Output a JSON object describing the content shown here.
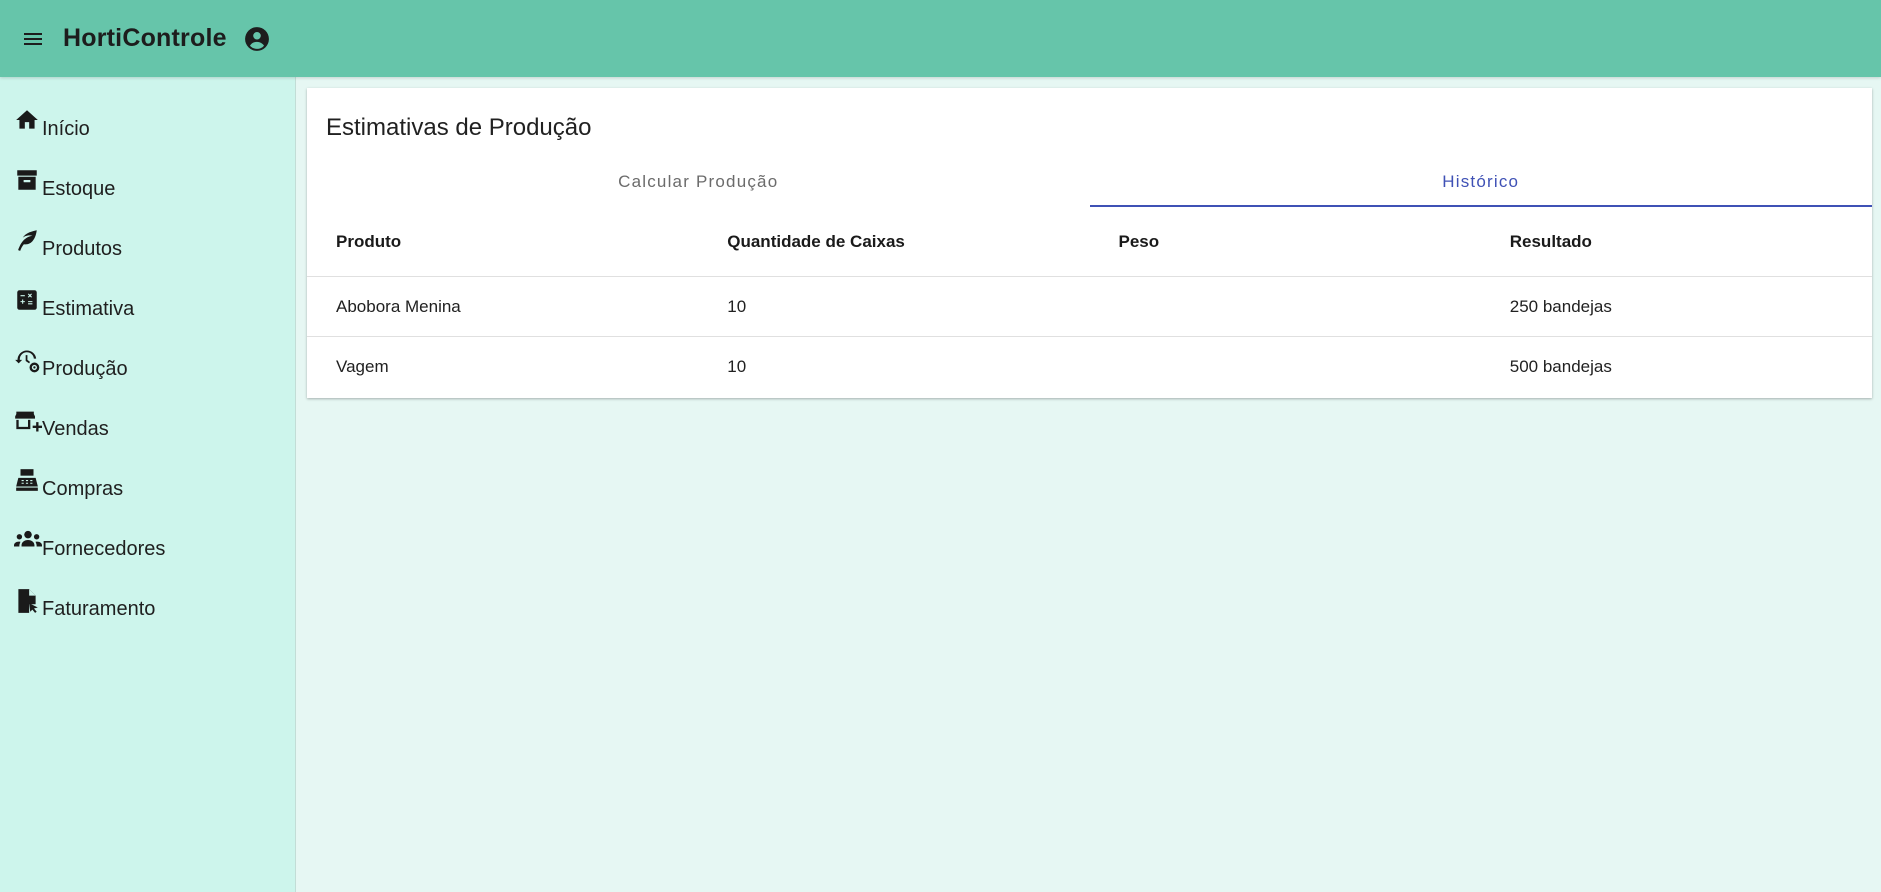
{
  "app": {
    "title": "HortiControle"
  },
  "icons": {
    "menu": "menu-icon",
    "account": "account-circle-icon"
  },
  "colors": {
    "appbar": "#66c5aa",
    "sidebar": "#cdf5ec",
    "background": "#e6f7f3",
    "accent": "#3f51b5"
  },
  "sidebar": {
    "items": [
      {
        "label": "Início",
        "icon": "home-icon"
      },
      {
        "label": "Estoque",
        "icon": "archive-icon"
      },
      {
        "label": "Produtos",
        "icon": "leaf-icon"
      },
      {
        "label": "Estimativa",
        "icon": "calculator-icon"
      },
      {
        "label": "Produção",
        "icon": "history-gear-icon"
      },
      {
        "label": "Vendas",
        "icon": "store-add-icon"
      },
      {
        "label": "Compras",
        "icon": "cash-register-icon"
      },
      {
        "label": "Fornecedores",
        "icon": "groups-icon"
      },
      {
        "label": "Faturamento",
        "icon": "file-cursor-icon"
      }
    ]
  },
  "main": {
    "title": "Estimativas de Produção",
    "tabs": [
      {
        "label": "Calcular Produção",
        "active": false
      },
      {
        "label": "Histórico",
        "active": true
      }
    ],
    "table": {
      "headers": [
        "Produto",
        "Quantidade de Caixas",
        "Peso",
        "Resultado"
      ],
      "rows": [
        [
          "Abobora Menina",
          "10",
          "",
          "250 bandejas"
        ],
        [
          "Vagem",
          "10",
          "",
          "500 bandejas"
        ]
      ]
    }
  }
}
